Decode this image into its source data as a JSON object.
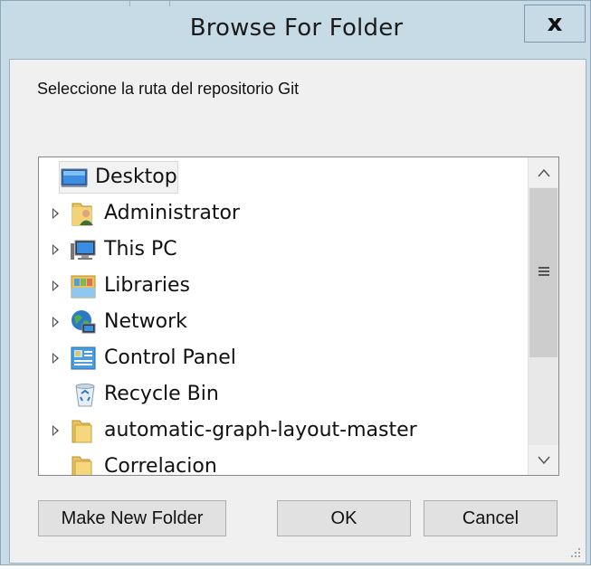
{
  "dialog": {
    "title": "Browse For Folder",
    "close_label": "x",
    "prompt": "Seleccione la ruta del repositorio Git"
  },
  "tree": {
    "items": [
      {
        "label": "Desktop",
        "icon": "desktop-icon",
        "expandable": false,
        "selected": true
      },
      {
        "label": "Administrator",
        "icon": "user-folder-icon",
        "expandable": true
      },
      {
        "label": "This PC",
        "icon": "computer-icon",
        "expandable": true
      },
      {
        "label": "Libraries",
        "icon": "libraries-icon",
        "expandable": true
      },
      {
        "label": "Network",
        "icon": "network-icon",
        "expandable": true
      },
      {
        "label": "Control Panel",
        "icon": "control-panel-icon",
        "expandable": true
      },
      {
        "label": "Recycle Bin",
        "icon": "recycle-bin-icon",
        "expandable": false
      },
      {
        "label": "automatic-graph-layout-master",
        "icon": "folder-icon",
        "expandable": true
      },
      {
        "label": "Correlacion",
        "icon": "folder-icon",
        "expandable": false
      }
    ]
  },
  "buttons": {
    "make_new_folder": "Make New Folder",
    "ok": "OK",
    "cancel": "Cancel"
  },
  "colors": {
    "frame": "#c7dbe6",
    "client": "#f0f0f0",
    "button": "#e1e1e1"
  }
}
